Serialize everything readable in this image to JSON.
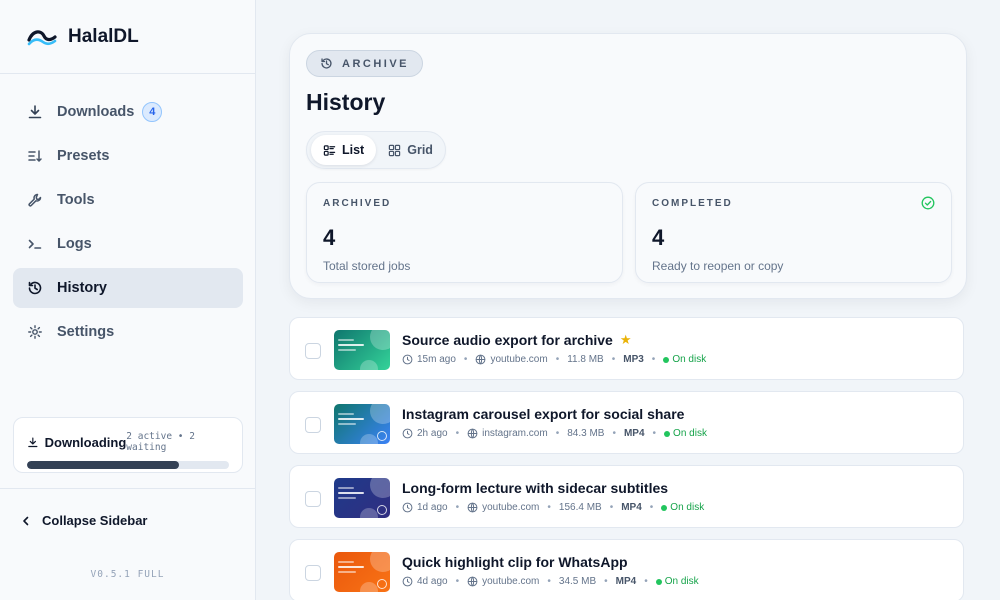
{
  "app": {
    "name": "HalalDL",
    "version": "V0.5.1 FULL"
  },
  "sidebar": {
    "items": [
      {
        "label": "Downloads",
        "icon": "download-icon",
        "badge": "4"
      },
      {
        "label": "Presets",
        "icon": "preset-list-icon"
      },
      {
        "label": "Tools",
        "icon": "wrench-icon"
      },
      {
        "label": "Logs",
        "icon": "terminal-icon"
      },
      {
        "label": "History",
        "icon": "history-icon",
        "active": true
      },
      {
        "label": "Settings",
        "icon": "gear-icon"
      }
    ],
    "downloading": {
      "label": "Downloading",
      "status": "2 active • 2 waiting",
      "progress": 0.75
    },
    "collapse_label": "Collapse Sidebar"
  },
  "page": {
    "eyebrow": "ARCHIVE",
    "title": "History",
    "views": [
      {
        "label": "List",
        "active": true
      },
      {
        "label": "Grid"
      }
    ],
    "stats": [
      {
        "label": "ARCHIVED",
        "value": "4",
        "sub": "Total stored jobs"
      },
      {
        "label": "COMPLETED",
        "value": "4",
        "sub": "Ready to reopen or copy"
      }
    ]
  },
  "jobs": [
    {
      "title": "Source audio export for archive",
      "starred": true,
      "time": "15m ago",
      "source": "youtube.com",
      "size": "11.8 MB",
      "format": "MP3",
      "status": "On disk",
      "thumb_colors": [
        "#0f766e",
        "#34d399"
      ]
    },
    {
      "title": "Instagram carousel export for social share",
      "time": "2h ago",
      "source": "instagram.com",
      "size": "84.3 MB",
      "format": "MP4",
      "status": "On disk",
      "thumb_colors": [
        "#0f766e",
        "#3b82f6"
      ]
    },
    {
      "title": "Long-form lecture with sidecar subtitles",
      "time": "1d ago",
      "source": "youtube.com",
      "size": "156.4 MB",
      "format": "MP4",
      "status": "On disk",
      "thumb_colors": [
        "#1e3a8a",
        "#312e81"
      ]
    },
    {
      "title": "Quick highlight clip for WhatsApp",
      "time": "4d ago",
      "source": "youtube.com",
      "size": "34.5 MB",
      "format": "MP4",
      "status": "On disk",
      "thumb_colors": [
        "#ea580c",
        "#f97316"
      ]
    }
  ]
}
